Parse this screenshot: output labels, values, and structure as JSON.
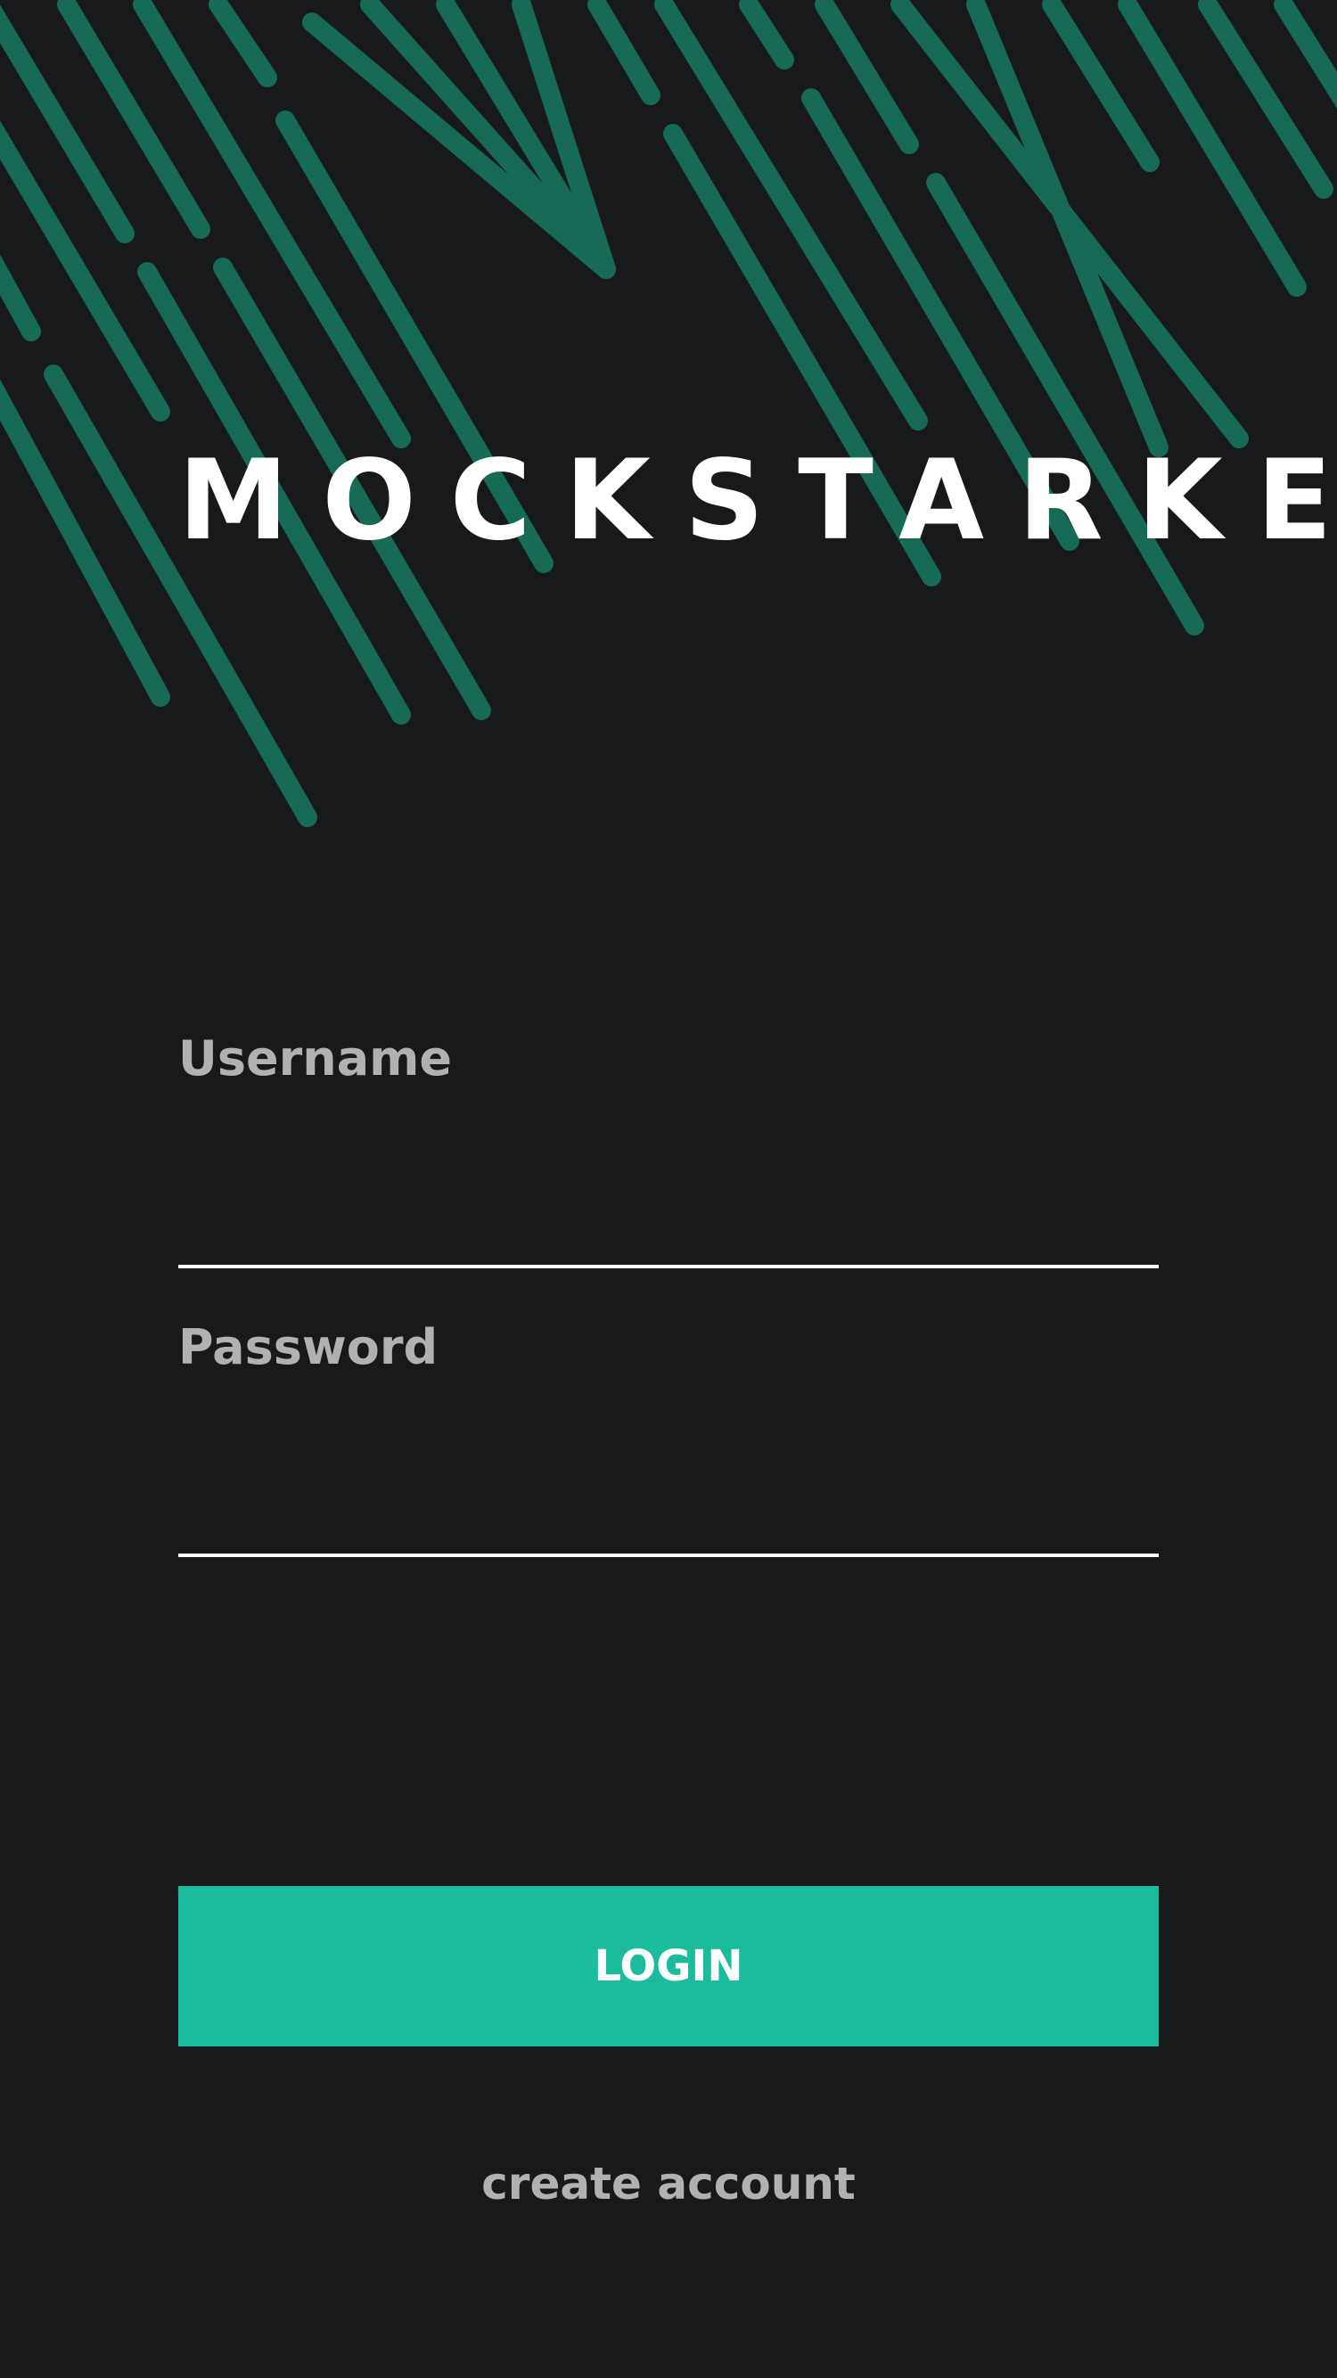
{
  "app": {
    "title": "MOCKSTARKET"
  },
  "login_form": {
    "username": {
      "label": "Username",
      "value": "",
      "placeholder": ""
    },
    "password": {
      "label": "Password",
      "value": "",
      "placeholder": ""
    },
    "login_button_label": "LOGIN",
    "create_account_label": "create account"
  },
  "colors": {
    "background": "#18191b",
    "accent": "#1bbc9b",
    "pattern_stripe": "#176a56",
    "title_text": "#ffffff",
    "label_text": "#b0b1b2",
    "input_underline": "#ffffff"
  }
}
